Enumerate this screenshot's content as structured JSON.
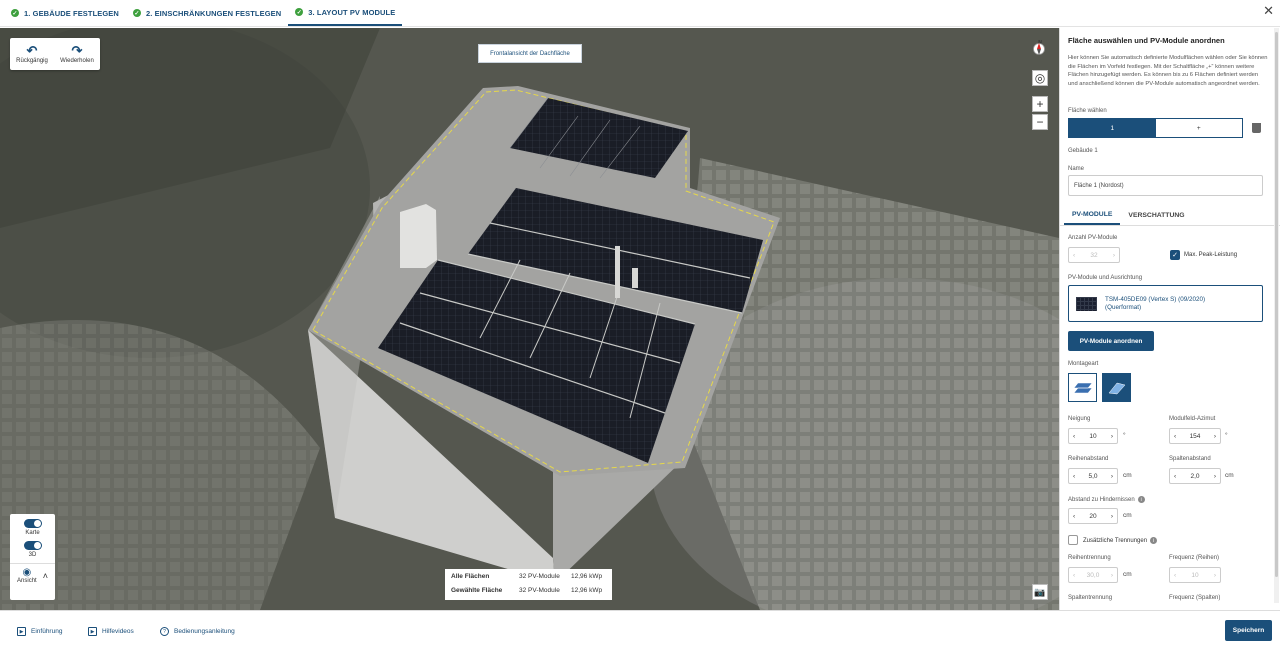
{
  "steps": [
    {
      "label": "1. GEBÄUDE FESTLEGEN"
    },
    {
      "label": "2. EINSCHRÄNKUNGEN FESTLEGEN"
    },
    {
      "label": "3. LAYOUT PV MODULE"
    }
  ],
  "close_icon": "close-icon",
  "toolbar": {
    "undo_label": "Rückgängig",
    "redo_label": "Wiederholen"
  },
  "view": {
    "tooltip": "Frontalansicht der Dachfläche",
    "compass_label": "N",
    "toggle_map": "Karte",
    "toggle_3d": "3D",
    "view_label": "Ansicht"
  },
  "summary": {
    "all_label": "Alle Flächen",
    "all_modules": "32 PV-Module",
    "all_kwp": "12,96 kWp",
    "sel_label": "Gewählte Fläche",
    "sel_modules": "32 PV-Module",
    "sel_kwp": "12,96 kWp"
  },
  "panel": {
    "title": "Fläche auswählen und PV-Module anordnen",
    "description": "Hier können Sie automatisch definierte Modulflächen wählen oder Sie können die Flächen im Vorfeld festlegen. Mit der Schaltfläche „+“ können weitere Flächen hinzugefügt werden. Es können bis zu 6 Flächen definiert werden und anschließend können die PV-Module automatisch angeordnet werden.",
    "area_select_label": "Fläche wählen",
    "area_1": "1",
    "area_add": "+",
    "building": "Gebäude 1",
    "name_label": "Name",
    "name_value": "Fläche 1 (Nordost)",
    "tab_pv": "PV-MODULE",
    "tab_shade": "VERSCHATTUNG",
    "count_label": "Anzahl PV-Module",
    "count_value": "32",
    "max_peak": "Max. Peak-Leistung",
    "module_label": "PV-Module und Ausrichtung",
    "module_line1": "TSM-405DE09 (Vertex S) (09/2020)",
    "module_line2": "(Querformat)",
    "arrange_button": "PV-Module anordnen",
    "mount_label": "Montageart",
    "tilt_label": "Neigung",
    "tilt_value": "10",
    "tilt_unit": "°",
    "azimuth_label": "Modulfeld-Azimut",
    "azimuth_value": "154",
    "azimuth_unit": "°",
    "row_gap_label": "Reihenabstand",
    "row_gap_value": "5,0",
    "row_gap_unit": "cm",
    "col_gap_label": "Spaltenabstand",
    "col_gap_value": "2,0",
    "col_gap_unit": "cm",
    "obstacle_label": "Abstand zu Hindernissen",
    "obstacle_value": "20",
    "obstacle_unit": "cm",
    "extra_sep": "Zusätzliche Trennungen",
    "row_sep_label": "Reihentrennung",
    "row_sep_value": "30,0",
    "row_sep_unit": "cm",
    "freq_rows_label": "Frequenz (Reihen)",
    "freq_rows_value": "10",
    "col_sep_label": "Spaltentrennung",
    "freq_cols_label": "Frequenz (Spalten)"
  },
  "footer": {
    "intro": "Einführung",
    "videos": "Hilfevideos",
    "manual": "Bedienungsanleitung",
    "save": "Speichern"
  }
}
